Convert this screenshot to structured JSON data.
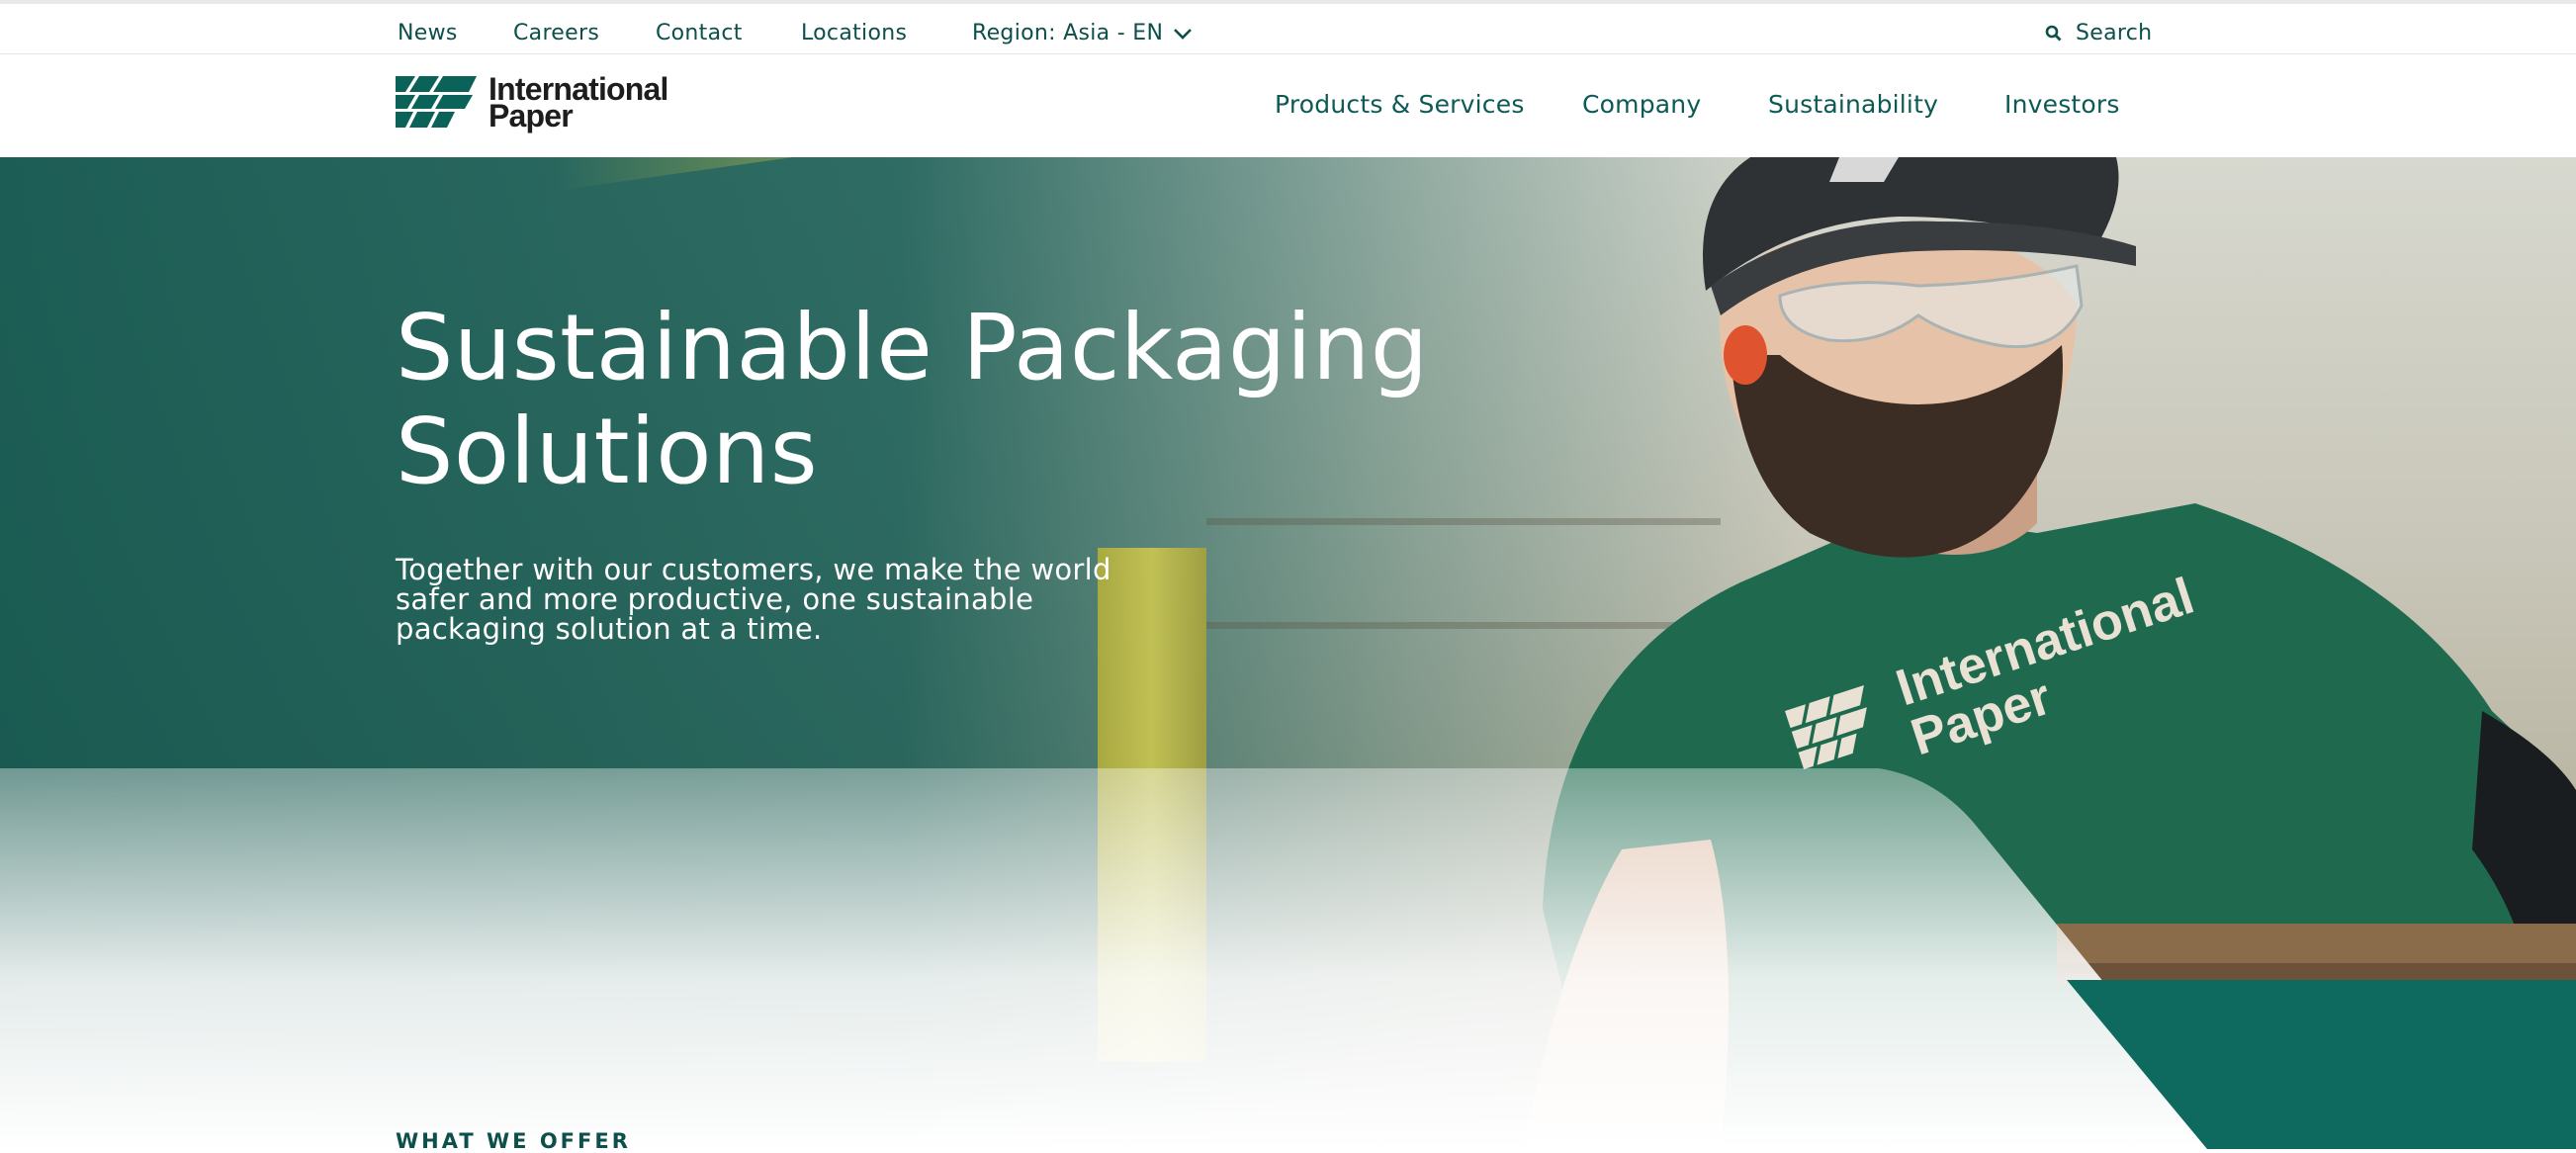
{
  "utility_nav": {
    "links": [
      "News",
      "Careers",
      "Contact",
      "Locations"
    ],
    "region_label": "Region: Asia - EN",
    "search_label": "Search"
  },
  "brand": {
    "name_line1": "International",
    "name_line2": "Paper",
    "color": "#0b6258"
  },
  "main_nav": {
    "items": [
      "Products & Services",
      "Company",
      "Sustainability",
      "Investors"
    ]
  },
  "hero": {
    "title_line1": "Sustainable Packaging",
    "title_line2": "Solutions",
    "subtitle": "Together with our customers, we make the world safer and more productive, one sustainable packaging solution at a time.",
    "shirt_logo_line1": "International",
    "shirt_logo_line2": "Paper"
  },
  "section": {
    "eyebrow": "WHAT WE OFFER"
  },
  "colors": {
    "primary_teal": "#0b5c55",
    "hero_overlay": "#0a544c",
    "accent_green": "#0e6a5e"
  },
  "icons": {
    "region_chevron": "chevron-down-icon",
    "search": "search-icon",
    "logo": "logo-icon"
  }
}
